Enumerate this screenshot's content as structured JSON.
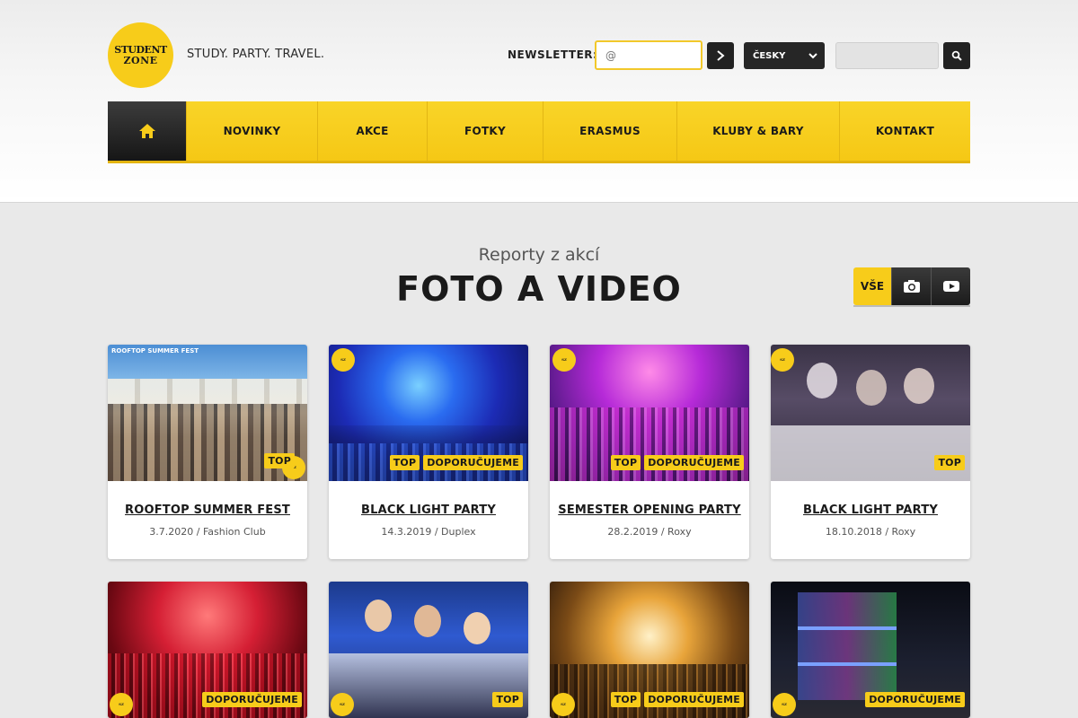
{
  "header": {
    "logo_line1": "STUDENT",
    "logo_line2": "ZONE",
    "tagline": "STUDY. PARTY. TRAVEL.",
    "newsletter_label": "NEWSLETTER:",
    "newsletter_placeholder": "@",
    "language": "ČESKY",
    "search_placeholder": ""
  },
  "nav": {
    "items": [
      "NOVINKY",
      "AKCE",
      "FOTKY",
      "ERASMUS",
      "KLUBY & BARY",
      "KONTAKT"
    ]
  },
  "section": {
    "subtitle": "Reporty z akcí",
    "title": "FOTO A VIDEO",
    "filter_all": "VŠE"
  },
  "cards": [
    {
      "title": "ROOFTOP SUMMER FEST",
      "date": "3.7.2020",
      "venue": "Fashion Club",
      "meta": "3.7.2020 / Fashion Club",
      "badges": [
        "TOP"
      ],
      "image_text": "ROOFTOP SUMMER FEST"
    },
    {
      "title": "BLACK LIGHT PARTY",
      "date": "14.3.2019",
      "venue": "Duplex",
      "meta": "14.3.2019 / Duplex",
      "badges": [
        "TOP",
        "DOPORUČUJEME"
      ]
    },
    {
      "title": "SEMESTER OPENING PARTY",
      "date": "28.2.2019",
      "venue": "Roxy",
      "meta": "28.2.2019 / Roxy",
      "badges": [
        "TOP",
        "DOPORUČUJEME"
      ]
    },
    {
      "title": "BLACK LIGHT PARTY",
      "date": "18.10.2018",
      "venue": "Roxy",
      "meta": "18.10.2018 / Roxy",
      "badges": [
        "TOP"
      ]
    },
    {
      "title": "",
      "meta": "",
      "badges": [
        "DOPORUČUJEME"
      ]
    },
    {
      "title": "",
      "meta": "",
      "badges": [
        "TOP"
      ]
    },
    {
      "title": "",
      "meta": "",
      "badges": [
        "TOP",
        "DOPORUČUJEME"
      ]
    },
    {
      "title": "",
      "meta": "",
      "badges": [
        "DOPORUČUJEME"
      ]
    }
  ],
  "colors": {
    "accent": "#f7cc1a",
    "dark": "#222222",
    "background": "#e9e9e9"
  }
}
